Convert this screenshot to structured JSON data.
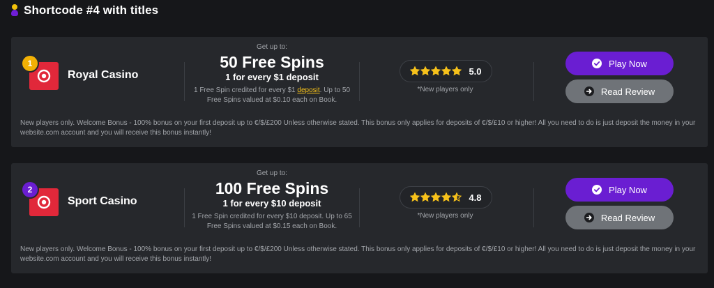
{
  "section": {
    "title": "Shortcode #4 with titles"
  },
  "colors": {
    "accent": "#6a1ed2",
    "gold": "#f2b105",
    "star": "#f6c11b",
    "logo_red": "#e1283a",
    "review_gray": "#6f7378"
  },
  "casinos": [
    {
      "rank": "1",
      "name": "Royal Casino",
      "bonus_pre": "Get up to:",
      "bonus_title": "50 Free Spins",
      "bonus_sub": "1 for every $1 deposit",
      "bonus_desc_a": "1 Free Spin credited for every $1 ",
      "bonus_desc_link": "deposit",
      "bonus_desc_b": ". Up to 50 Free Spins valued at $0.10 each on Book.",
      "rating": "5.0",
      "rating_value": 5.0,
      "new_players": "*New players only",
      "play_label": "Play Now",
      "review_label": "Read Review",
      "terms": "New players only. Welcome Bonus - 100% bonus on your first deposit up to €/$/£200 Unless otherwise stated. This bonus only applies for deposits of €/$/£10 or higher! All you need to do is just deposit the money in your website.com account and you will receive this bonus instantly!"
    },
    {
      "rank": "2",
      "name": "Sport Casino",
      "bonus_pre": "Get up to:",
      "bonus_title": "100 Free Spins",
      "bonus_sub": "1 for every $10 deposit",
      "bonus_desc_a": "1 Free Spin credited for every $10 deposit. Up to 65 Free Spins valued at $0.15 each on Book.",
      "rating": "4.8",
      "rating_value": 4.8,
      "new_players": "*New players only",
      "play_label": "Play Now",
      "review_label": "Read Review",
      "terms": "New players only. Welcome Bonus - 100% bonus on your first deposit up to €/$/£200 Unless otherwise stated. This bonus only applies for deposits of €/$/£10 or higher! All you need to do is just deposit the money in your website.com account and you will receive this bonus instantly!"
    }
  ]
}
